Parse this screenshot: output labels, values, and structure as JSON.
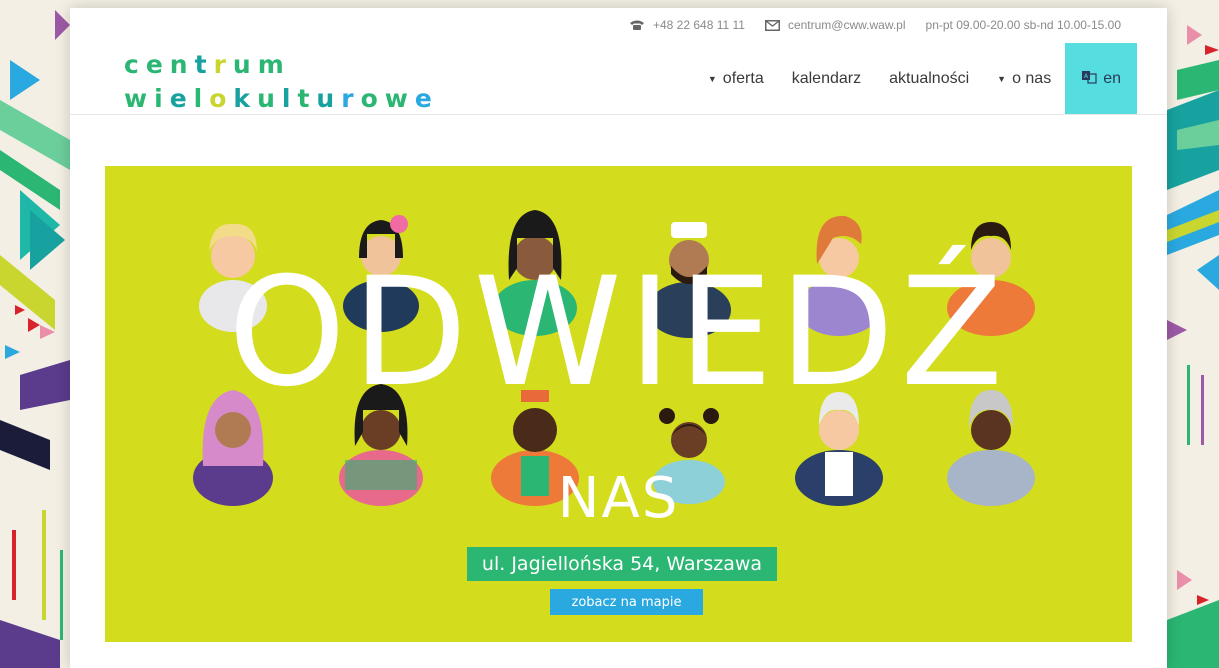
{
  "topbar": {
    "phone": "+48 22 648 11 11",
    "email": "centrum@cww.waw.pl",
    "hours": "pn-pt 09.00-20.00 sb-nd 10.00-15.00"
  },
  "logo": {
    "line1": "centrum",
    "line2": "wielokulturowe"
  },
  "nav": {
    "items": [
      {
        "label": "oferta",
        "has_dropdown": true
      },
      {
        "label": "kalendarz",
        "has_dropdown": false
      },
      {
        "label": "aktualności",
        "has_dropdown": false
      },
      {
        "label": "o nas",
        "has_dropdown": true
      }
    ],
    "lang_label": "en"
  },
  "banner": {
    "headline": "ODWIEDŹ",
    "subheadline": "NAS",
    "address": "ul. Jagiellońska 54, Warszawa",
    "map_button": "zobacz na mapie"
  },
  "colors": {
    "banner_bg": "#d3dd1e",
    "address_bg": "#2bb673",
    "map_button_bg": "#2aa9e0",
    "lang_bg": "#55dde0"
  }
}
